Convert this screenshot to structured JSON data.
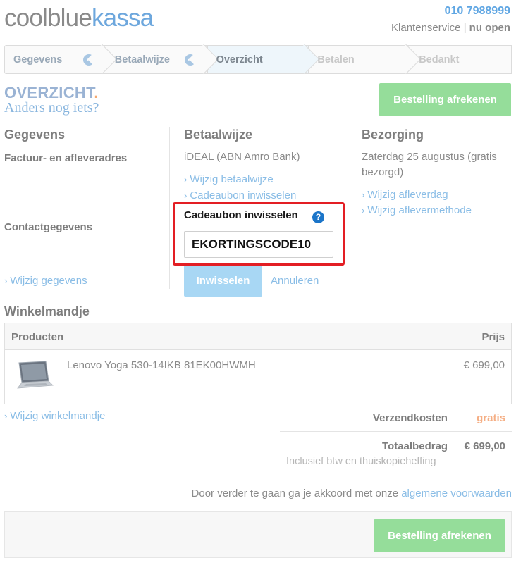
{
  "header": {
    "logo_part1": "coolblue",
    "logo_part2": "kassa",
    "phone": "010 7988999",
    "service_label": "Klantenservice",
    "service_sep": "|",
    "service_status": "nu open"
  },
  "steps": [
    {
      "label": "Gegevens",
      "state": "done"
    },
    {
      "label": "Betaalwijze",
      "state": "done"
    },
    {
      "label": "Overzicht",
      "state": "active"
    },
    {
      "label": "Betalen",
      "state": "future"
    },
    {
      "label": "Bedankt",
      "state": "future"
    }
  ],
  "overview": {
    "title": "OVERZICHT",
    "title_dot": ".",
    "subtitle": "Anders nog iets?",
    "checkout_button": "Bestelling afrekenen"
  },
  "gegevens": {
    "heading": "Gegevens",
    "address_label": "Factuur- en afleveradres",
    "contact_label": "Contactgegevens",
    "edit_link": "Wijzig gegevens"
  },
  "betaalwijze": {
    "heading": "Betaalwijze",
    "method": "iDEAL (ABN Amro Bank)",
    "edit_link": "Wijzig betaalwijze",
    "voucher_link": "Cadeaubon inwisselen",
    "voucher_title": "Cadeaubon inwisselen",
    "voucher_help": "?",
    "voucher_value": "EKORTINGSCODE10",
    "redeem_button": "Inwisselen",
    "cancel_link": "Annuleren"
  },
  "bezorging": {
    "heading": "Bezorging",
    "date_line1": "Zaterdag 25 augustus (gratis",
    "date_line2": "bezorgd)",
    "edit_day_link": "Wijzig afleverdag",
    "edit_method_link": "Wijzig aflevermethode"
  },
  "cart": {
    "heading": "Winkelmandje",
    "col_products": "Producten",
    "col_price": "Prijs",
    "items": [
      {
        "name": "Lenovo Yoga 530-14IKB 81EK00HWMH",
        "price": "€ 699,00",
        "icon": "laptop-image"
      }
    ],
    "edit_link": "Wijzig winkelmandje"
  },
  "totals": {
    "shipping_label": "Verzendkosten",
    "shipping_value": "gratis",
    "total_label": "Totaalbedrag",
    "total_value": "€ 699,00",
    "incl_note": "Inclusief btw en thuiskopieheffing"
  },
  "agreement": {
    "text": "Door verder te gaan ga je akkoord met onze",
    "link": "algemene voorwaarden"
  },
  "footer": {
    "checkout_button": "Bestelling afrekenen"
  },
  "colors": {
    "brand_blue": "#6da7dd",
    "link_blue": "#8abde6",
    "green_button": "#95dd9a",
    "highlight_red": "#e31e24",
    "accent_orange": "#f4a971"
  }
}
